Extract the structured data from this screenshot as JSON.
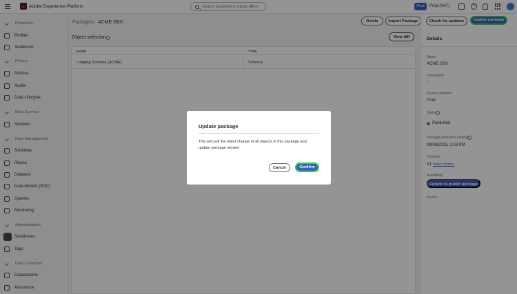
{
  "topbar": {
    "app_title": "Adobe Experience Platform",
    "search_placeholder": "Search Experience Cloud (⌘+/)",
    "env_badge": "Prod",
    "sandbox": "Prod (VA7)",
    "help_glyph": "?"
  },
  "sidebar": {
    "sections": [
      {
        "label": "Prospects",
        "items": [
          "Profiles",
          "Audiences"
        ]
      },
      {
        "label": "Privacy",
        "items": [
          "Policies",
          "Audits",
          "Data Lifecycle"
        ]
      },
      {
        "label": "Data Science",
        "items": [
          "Services"
        ]
      },
      {
        "label": "Data Management",
        "items": [
          "Schemas",
          "Places",
          "Datasets",
          "Data Models (POC)",
          "Queries",
          "Monitoring"
        ]
      },
      {
        "label": "Administration",
        "items": [
          "Sandboxes",
          "Tags"
        ]
      },
      {
        "label": "Data Collection",
        "items": [
          "Datastreams",
          "Assurance"
        ]
      }
    ],
    "active_item": "Sandboxes"
  },
  "breadcrumb": {
    "parent": "Packages",
    "separator": "›",
    "current": "ACME SBX"
  },
  "toolbar": {
    "delete": "Delete",
    "import": "Import Package",
    "check": "Check for updates",
    "update": "Update package"
  },
  "object_selection": {
    "title": "Object selection",
    "view_diff": "View diff",
    "columns": [
      "NAME",
      "TYPE"
    ],
    "rows": [
      {
        "name": "Lodging Schema (ACME)",
        "type": "Schema"
      }
    ]
  },
  "details": {
    "heading": "Details",
    "name_label": "Name",
    "name_value": "ACME SBX",
    "description_label": "Description",
    "description_value": "-",
    "source_sandbox_label": "Source sandbox",
    "source_sandbox_value": "Prod",
    "status_label": "Status",
    "status_value": "Published",
    "expiration_label": "Package expiration settings",
    "expiration_value": "09/08/2025, 1:03 PM",
    "versions_label": "Versions",
    "version_value": "V1",
    "view_history": "View history",
    "availability_label": "Availability",
    "availability_button": "Update to public package",
    "source_label": "Source",
    "source_value": "-"
  },
  "dialog": {
    "title": "Update package",
    "body": "This will pull the latest change of all objects in this package and update package version.",
    "cancel": "Cancel",
    "confirm": "Confirm"
  },
  "colors": {
    "accent": "#3d5fcc",
    "highlight": "#2bd83a",
    "status_published": "#2d9d78"
  }
}
